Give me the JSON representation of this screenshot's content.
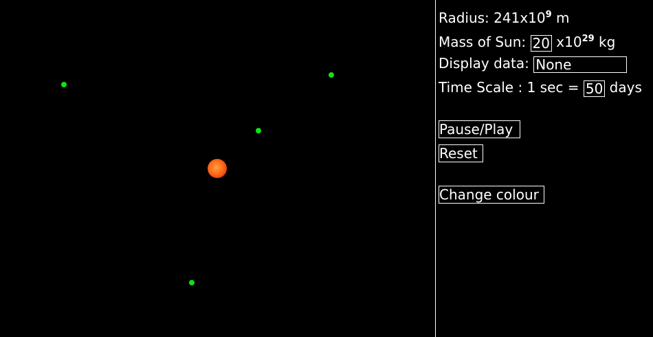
{
  "simulation": {
    "colors": {
      "background": "#000000",
      "planet": "#14e014",
      "sun": "#ff6a1a"
    },
    "planets": [
      "planet",
      "planet",
      "planet",
      "planet"
    ],
    "sun": "sun"
  },
  "panel": {
    "radius_label": "Radius: 241x10",
    "radius_exp": "9",
    "radius_unit": " m",
    "mass_label": "Mass of Sun: ",
    "mass_value": "20",
    "mass_unit_prefix": " x10",
    "mass_unit_exp": "29",
    "mass_unit_suffix": " kg",
    "display_label": "Display data: ",
    "display_value": "None",
    "time_label": "Time Scale : 1 sec = ",
    "time_value": "50",
    "time_unit": " days",
    "pause_play_label": "Pause/Play",
    "reset_label": "Reset",
    "change_colour_label": "Change colour"
  }
}
